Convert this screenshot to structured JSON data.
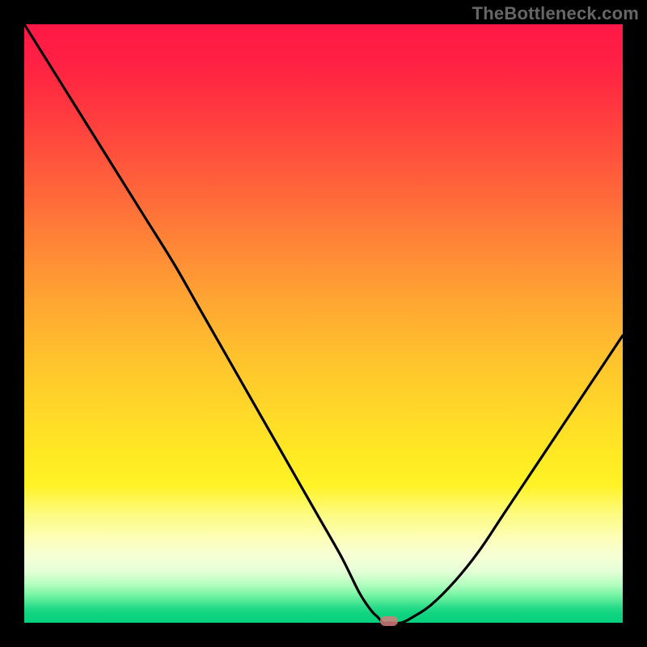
{
  "watermark": "TheBottleneck.com",
  "chart_data": {
    "type": "line",
    "title": "",
    "xlabel": "",
    "ylabel": "",
    "xlim": [
      0,
      100
    ],
    "ylim": [
      0,
      100
    ],
    "grid": false,
    "series": [
      {
        "name": "curve",
        "x": [
          0,
          5,
          10,
          15,
          20,
          25,
          29,
          33,
          37,
          41,
          45,
          49,
          53,
          56,
          58,
          59,
          60,
          61,
          63,
          65,
          68,
          72,
          76,
          80,
          84,
          88,
          92,
          96,
          100
        ],
        "y": [
          100,
          92,
          84,
          76,
          68,
          60,
          53,
          46,
          39,
          32,
          25,
          18,
          11,
          5,
          2,
          1,
          0,
          0,
          0,
          1,
          3,
          7,
          12,
          18,
          24,
          30,
          36,
          42,
          48
        ]
      }
    ],
    "marker": {
      "x": 61,
      "y": 0
    },
    "background_gradient": {
      "stops": [
        {
          "pct": 0,
          "color": "#ff1846"
        },
        {
          "pct": 50,
          "color": "#ffb82f"
        },
        {
          "pct": 82,
          "color": "#fdfb83"
        },
        {
          "pct": 100,
          "color": "#07d07c"
        }
      ]
    }
  }
}
